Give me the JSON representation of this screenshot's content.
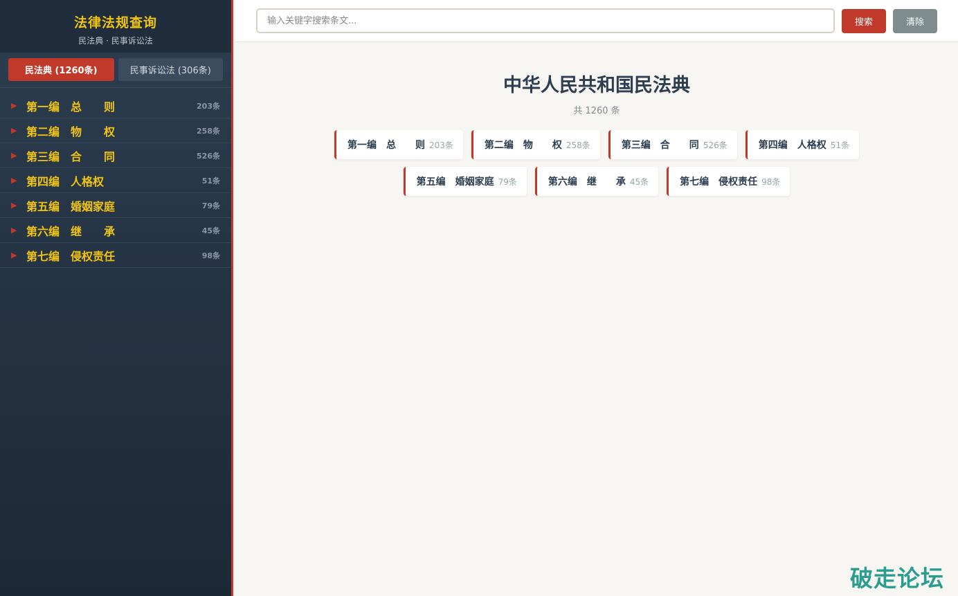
{
  "sidebar": {
    "title": "法律法规查询",
    "subtitle": "民法典 · 民事诉讼法",
    "tabs": [
      {
        "label": "民法典 (1260条)",
        "active": true
      },
      {
        "label": "民事诉讼法 (306条)",
        "active": false
      }
    ],
    "items": [
      {
        "label": "第一编　总　　则",
        "count": "203条"
      },
      {
        "label": "第二编　物　　权",
        "count": "258条"
      },
      {
        "label": "第三编　合　　同",
        "count": "526条"
      },
      {
        "label": "第四编　人格权",
        "count": "51条"
      },
      {
        "label": "第五编　婚姻家庭",
        "count": "79条"
      },
      {
        "label": "第六编　继　　承",
        "count": "45条"
      },
      {
        "label": "第七编　侵权责任",
        "count": "98条"
      }
    ]
  },
  "search": {
    "placeholder": "输入关键字搜索条文...",
    "value": "",
    "search_label": "搜索",
    "clear_label": "清除"
  },
  "main": {
    "title": "中华人民共和国民法典",
    "total": "共 1260 条",
    "cards": [
      {
        "label": "第一编　总　　则",
        "count": "203条"
      },
      {
        "label": "第二编　物　　权",
        "count": "258条"
      },
      {
        "label": "第三编　合　　同",
        "count": "526条"
      },
      {
        "label": "第四编　人格权",
        "count": "51条"
      },
      {
        "label": "第五编　婚姻家庭",
        "count": "79条"
      },
      {
        "label": "第六编　继　　承",
        "count": "45条"
      },
      {
        "label": "第七编　侵权责任",
        "count": "98条"
      }
    ]
  },
  "watermark": "破走论坛",
  "colors": {
    "accent": "#c0392b",
    "highlight": "#f1c40f",
    "sidebar_bg": "#2c3e50",
    "watermark": "#2a9d8f"
  },
  "icons": {
    "nav_arrow": "triangle-right-icon"
  }
}
